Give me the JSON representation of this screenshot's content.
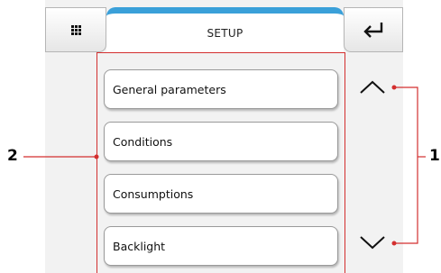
{
  "header": {
    "title": "SETUP",
    "menu_icon": "grid-icon",
    "back_icon": "enter-return-icon"
  },
  "menu": {
    "items": [
      {
        "label": "General parameters"
      },
      {
        "label": "Conditions"
      },
      {
        "label": "Consumptions"
      },
      {
        "label": "Backlight"
      }
    ]
  },
  "navigation": {
    "up_icon": "chevron-up-icon",
    "down_icon": "chevron-down-icon"
  },
  "callouts": {
    "list_label": "2",
    "scroll_label": "1"
  },
  "colors": {
    "accent": "#3aa0d9",
    "callout_line": "#d32f2f",
    "screen_bg": "#f2f2f2"
  }
}
